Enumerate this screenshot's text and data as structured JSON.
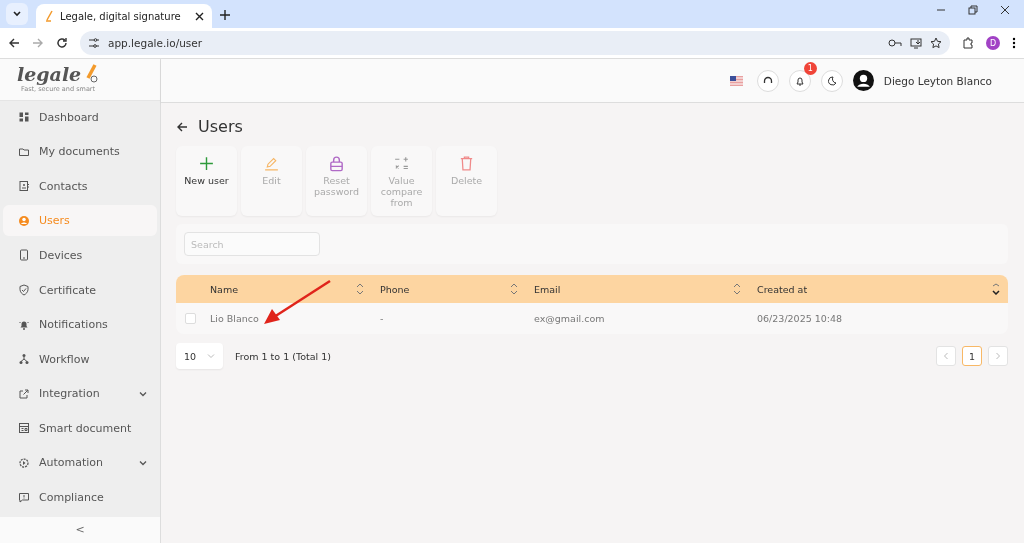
{
  "browser": {
    "tab_title": "Legale, digital signature",
    "url": "app.legale.io/user",
    "profile_initial": "D"
  },
  "logo": {
    "name": "legale",
    "tagline": "Fast, secure and smart"
  },
  "sidebar": {
    "items": [
      {
        "label": "Dashboard",
        "selected": false,
        "expandable": false
      },
      {
        "label": "My documents",
        "selected": false,
        "expandable": false
      },
      {
        "label": "Contacts",
        "selected": false,
        "expandable": false
      },
      {
        "label": "Users",
        "selected": true,
        "expandable": false
      },
      {
        "label": "Devices",
        "selected": false,
        "expandable": false
      },
      {
        "label": "Certificate",
        "selected": false,
        "expandable": false
      },
      {
        "label": "Notifications",
        "selected": false,
        "expandable": false
      },
      {
        "label": "Workflow",
        "selected": false,
        "expandable": false
      },
      {
        "label": "Integration",
        "selected": false,
        "expandable": true
      },
      {
        "label": "Smart document",
        "selected": false,
        "expandable": false
      },
      {
        "label": "Automation",
        "selected": false,
        "expandable": true
      },
      {
        "label": "Compliance",
        "selected": false,
        "expandable": false
      }
    ],
    "collapse": "<"
  },
  "header": {
    "notification_count": "1",
    "user_name": "Diego Leyton Blanco"
  },
  "page": {
    "title": "Users",
    "actions": [
      {
        "label": "New user",
        "disabled": false
      },
      {
        "label": "Edit",
        "disabled": true
      },
      {
        "label": "Reset password",
        "disabled": true
      },
      {
        "label": "Value compare from",
        "disabled": true
      },
      {
        "label": "Delete",
        "disabled": true
      }
    ],
    "search": {
      "placeholder": "Search"
    },
    "table": {
      "columns": [
        {
          "label": "Name",
          "sorted": false
        },
        {
          "label": "Phone",
          "sorted": false
        },
        {
          "label": "Email",
          "sorted": false
        },
        {
          "label": "Created at",
          "sorted": true
        }
      ],
      "rows": [
        {
          "checked": false,
          "cells": [
            "Lio Blanco",
            "-",
            "ex@gmail.com",
            "06/23/2025 10:48"
          ]
        }
      ]
    },
    "page_size": "10",
    "range": "From 1 to 1 (Total 1)",
    "pages": [
      {
        "label": "1",
        "selected": true
      }
    ]
  }
}
